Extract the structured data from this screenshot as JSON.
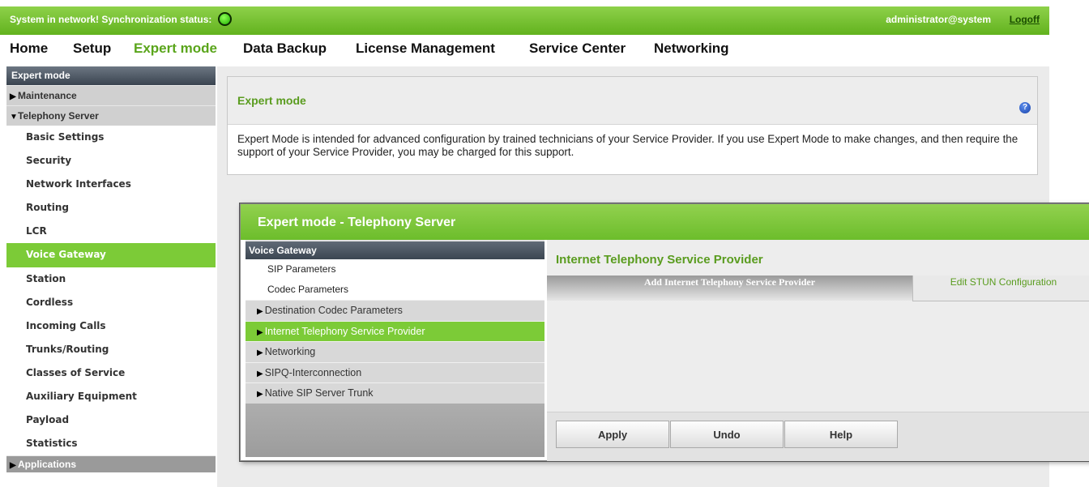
{
  "status": {
    "prefix": "System in network!  Synchronization status:",
    "user": "administrator@system",
    "logoff": "Logoff"
  },
  "menu": [
    {
      "label": "Home"
    },
    {
      "label": "Setup"
    },
    {
      "label": "Expert mode",
      "active": true
    },
    {
      "label": "Data Backup"
    },
    {
      "label": "License Management"
    },
    {
      "label": "Service Center"
    },
    {
      "label": "Networking"
    }
  ],
  "sidebar": {
    "header": "Expert mode",
    "groups": {
      "maintenance": "Maintenance",
      "telephony": "Telephony Server",
      "applications": "Applications"
    },
    "items": [
      "Basic Settings",
      "Security",
      "Network Interfaces",
      "Routing",
      "LCR",
      "Voice Gateway",
      "Station",
      "Cordless",
      "Incoming Calls",
      "Trunks/Routing",
      "Classes of Service",
      "Auxiliary Equipment",
      "Payload",
      "Statistics"
    ],
    "active_item": "Voice Gateway"
  },
  "info": {
    "title": "Expert mode",
    "text": "Expert Mode is intended for advanced configuration by trained technicians of your Service Provider. If you use Expert Mode to make changes, and then require the support of your Service Provider, you may be charged for this support."
  },
  "overlay": {
    "title": "Expert mode - Telephony Server",
    "left": {
      "header": "Voice Gateway",
      "subitems": [
        "SIP Parameters",
        "Codec Parameters"
      ],
      "groups": [
        "Destination Codec Parameters",
        "Internet Telephony Service Provider",
        "Networking",
        "SIPQ-Interconnection",
        "Native SIP Server Trunk"
      ],
      "active_group": "Internet Telephony Service Provider"
    },
    "right": {
      "title": "Internet Telephony Service Provider",
      "tab_active": "Add Internet Telephony Service Provider",
      "tab_inactive": "Edit STUN Configuration",
      "buttons": {
        "apply": "Apply",
        "undo": "Undo",
        "help": "Help"
      }
    }
  },
  "colors": {
    "accent_green": "#6cbd2b",
    "active_green": "#7ccb37",
    "title_green": "#5a9c1f",
    "header_dark": "#3a4450"
  }
}
